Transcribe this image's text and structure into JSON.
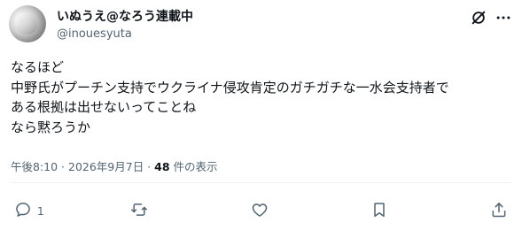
{
  "author": {
    "display_name": "いぬうえ@なろう連載中",
    "handle": "@inouesyuta"
  },
  "post": {
    "lines": [
      "なるほど",
      "中野氏がプーチン支持でウクライナ侵攻肯定のガチガチな一水会支持者で",
      "ある根拠は出せないってことね",
      "なら黙ろうか"
    ],
    "timestamp": "午後8:10 · 2026年9月7日 · ",
    "views_count": "48",
    "views_label": " 件の表示"
  },
  "actions": {
    "reply_count": "1"
  },
  "icons": {
    "top": [
      "grok-icon",
      "more-icon"
    ],
    "actions": [
      "reply-icon",
      "retweet-icon",
      "like-icon",
      "bookmark-icon",
      "share-icon"
    ]
  },
  "colors": {
    "text": "#0f1419",
    "secondary": "#536471",
    "divider": "#eff3f4"
  }
}
